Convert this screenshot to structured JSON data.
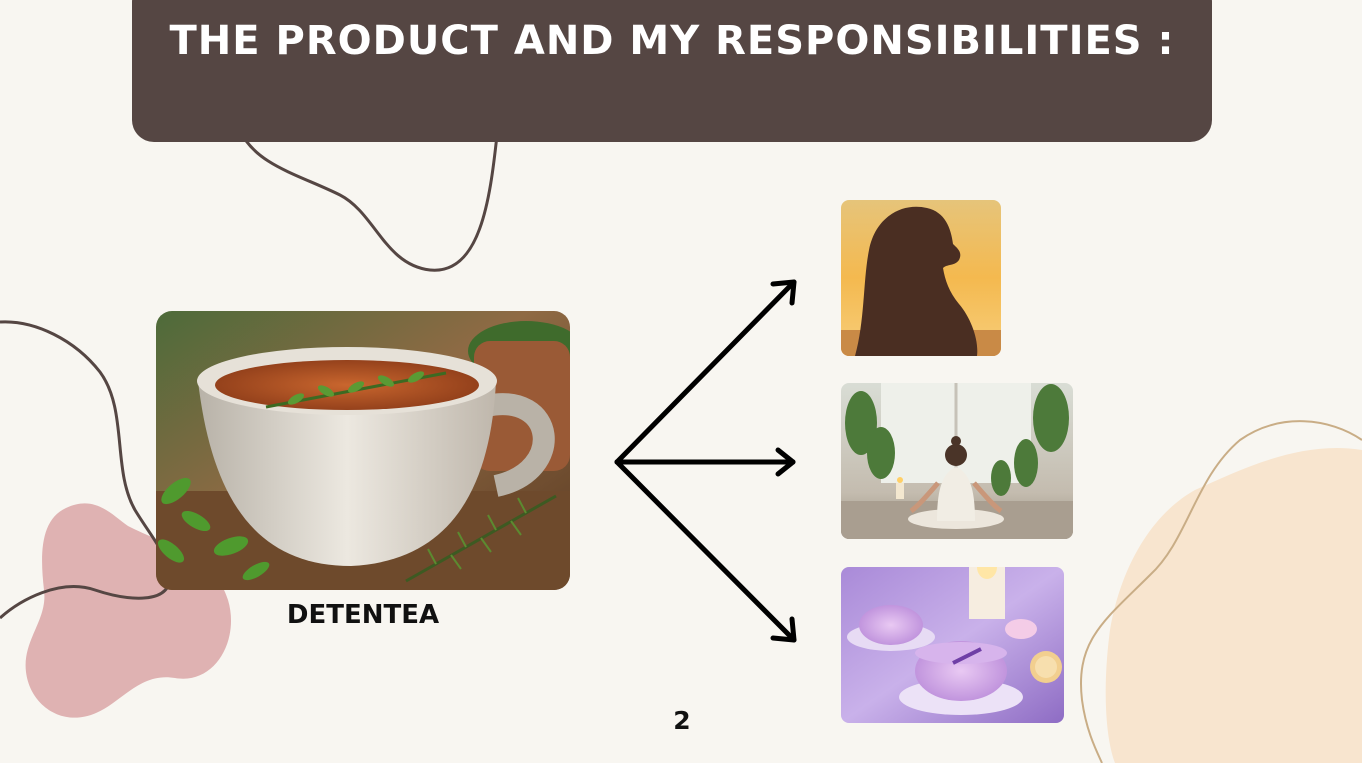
{
  "slide": {
    "title": "THE PRODUCT AND MY RESPONSIBILITIES :",
    "product_label": "DETENTEA",
    "page_number": "2"
  },
  "colors": {
    "background": "#f8f6f1",
    "banner": "#554643",
    "title_text": "#ffffff",
    "pink_blob": "#dfb2b2",
    "peach_blob": "#f8e5cf",
    "dark_line": "#554643",
    "tan_line": "#c9ad86",
    "arrow": "#000000"
  },
  "images": {
    "main": "herbal-tea-cup",
    "branches": [
      "sunset-silhouette",
      "meditation-pose",
      "lavender-tea-cups"
    ]
  }
}
